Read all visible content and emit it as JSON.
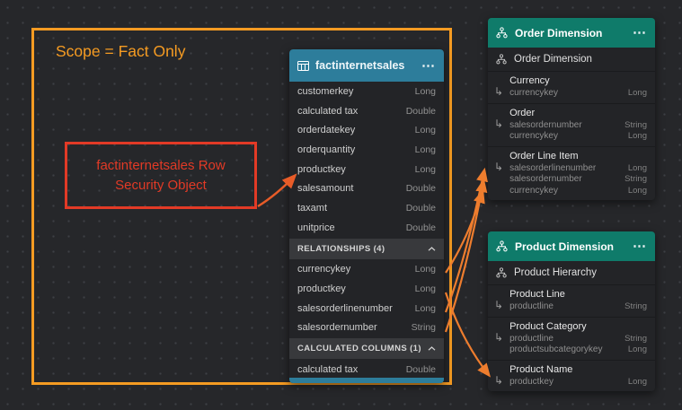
{
  "colors": {
    "orange": "#f59b22",
    "red": "#e23a26",
    "fact-header": "#2d7d9b",
    "dim-header": "#0f7b6a",
    "arrow": "#ee7d2e",
    "arrow-left": "#e85c28"
  },
  "icons": {
    "menu": "⋯",
    "elbow": "↳"
  },
  "annotations": {
    "scope_label": "Scope = Fact Only",
    "security_label": "factinternetsales Row Security Object"
  },
  "fact_table": {
    "title": "factinternetsales",
    "columns": [
      {
        "name": "customerkey",
        "type": "Long"
      },
      {
        "name": "calculated tax",
        "type": "Double"
      },
      {
        "name": "orderdatekey",
        "type": "Long"
      },
      {
        "name": "orderquantity",
        "type": "Long"
      },
      {
        "name": "productkey",
        "type": "Long"
      },
      {
        "name": "salesamount",
        "type": "Double"
      },
      {
        "name": "taxamt",
        "type": "Double"
      },
      {
        "name": "unitprice",
        "type": "Double"
      }
    ],
    "relationships_title": "RELATIONSHIPS (4)",
    "relationships": [
      {
        "name": "currencykey",
        "type": "Long"
      },
      {
        "name": "productkey",
        "type": "Long"
      },
      {
        "name": "salesorderlinenumber",
        "type": "Long"
      },
      {
        "name": "salesordernumber",
        "type": "String"
      }
    ],
    "calculated_title": "CALCULATED COLUMNS (1)",
    "calculated": [
      {
        "name": "calculated tax",
        "type": "Double"
      }
    ]
  },
  "order_dimension": {
    "title": "Order Dimension",
    "hierarchy_name": "Order Dimension",
    "levels": [
      {
        "name": "Currency",
        "fields": [
          {
            "name": "currencykey",
            "type": "Long"
          }
        ]
      },
      {
        "name": "Order",
        "fields": [
          {
            "name": "salesordernumber",
            "type": "String"
          },
          {
            "name": "currencykey",
            "type": "Long"
          }
        ]
      },
      {
        "name": "Order Line Item",
        "fields": [
          {
            "name": "salesorderlinenumber",
            "type": "Long"
          },
          {
            "name": "salesordernumber",
            "type": "String"
          },
          {
            "name": "currencykey",
            "type": "Long"
          }
        ]
      }
    ]
  },
  "product_dimension": {
    "title": "Product Dimension",
    "hierarchy_name": "Product Hierarchy",
    "levels": [
      {
        "name": "Product Line",
        "fields": [
          {
            "name": "productline",
            "type": "String"
          }
        ]
      },
      {
        "name": "Product Category",
        "fields": [
          {
            "name": "productline",
            "type": "String"
          },
          {
            "name": "productsubcategorykey",
            "type": "Long"
          }
        ]
      },
      {
        "name": "Product Name",
        "fields": [
          {
            "name": "productkey",
            "type": "Long"
          }
        ]
      }
    ]
  }
}
